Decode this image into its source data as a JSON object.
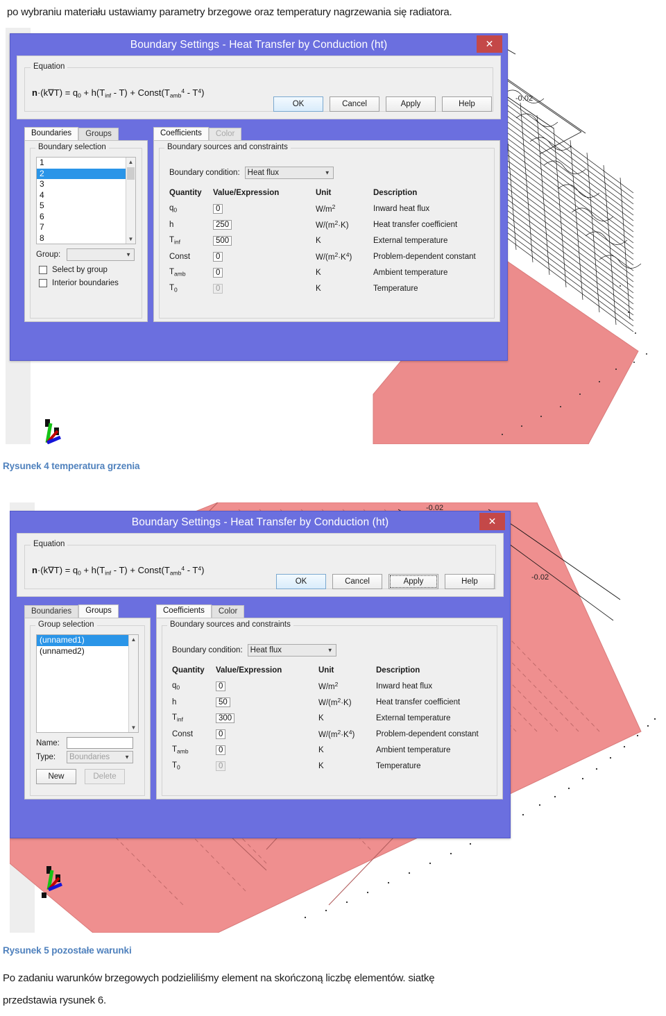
{
  "document": {
    "intro_paragraph": "po wybraniu materiału ustawiamy parametry brzegowe  oraz temperatury nagrzewania się radiatora.",
    "caption_fig4": "Rysunek 4 temperatura grzenia",
    "caption_fig5": "Rysunek 5 pozostałe warunki",
    "outro_line1": "Po zadaniu warunków brzegowych podzieliliśmy element  na skończoną liczbę elementów. siatkę",
    "outro_line2": "przedstawia rysunek 6.",
    "caption_color": "#4f81bd"
  },
  "figure1": {
    "axis_label": "-0.02",
    "geometry_color": "#ec8c8c",
    "triad_name": "axis-triad-icon"
  },
  "figure2": {
    "axis_label_top": "-0.02",
    "axis_label_right": "-0.02",
    "geometry_color": "#ec8c8c",
    "triad_name": "axis-triad-icon"
  },
  "dialog1": {
    "title": "Boundary Settings - Heat Transfer by Conduction (ht)",
    "close_label": "✕",
    "titlebar_color": "#6b6fdf",
    "close_color": "#c44848",
    "equation": {
      "legend": "Equation",
      "lhs_bold": "n",
      "text": "·(k∇T) = q0 + h(Tinf - T) + Const(Tamb4 - T4)"
    },
    "left_tabs": [
      {
        "label": "Boundaries",
        "active": true,
        "disabled": false
      },
      {
        "label": "Groups",
        "active": false,
        "disabled": false
      }
    ],
    "selection": {
      "legend": "Boundary selection",
      "items": [
        "1",
        "2",
        "3",
        "4",
        "5",
        "6",
        "7",
        "8"
      ],
      "selected_index": 1,
      "group_label": "Group:",
      "group_value": "",
      "checkboxes": [
        {
          "label": "Select by group",
          "checked": false
        },
        {
          "label": "Interior boundaries",
          "checked": false
        }
      ]
    },
    "right_tabs": [
      {
        "label": "Coefficients",
        "active": true,
        "disabled": false
      },
      {
        "label": "Color",
        "active": false,
        "disabled": true
      }
    ],
    "coefficients": {
      "legend": "Boundary sources and constraints",
      "bc_label": "Boundary condition:",
      "bc_value": "Heat flux",
      "headers": [
        "Quantity",
        "Value/Expression",
        "Unit",
        "Description"
      ],
      "rows": [
        {
          "qty": "q0",
          "value": "0",
          "unit": "W/m2",
          "desc": "Inward heat flux",
          "disabled": false,
          "caret": false
        },
        {
          "qty": "h",
          "value": "250",
          "unit": "W/(m2·K)",
          "desc": "Heat transfer coefficient",
          "disabled": false,
          "caret": false
        },
        {
          "qty": "Tinf",
          "value": "500",
          "unit": "K",
          "desc": "External temperature",
          "disabled": false,
          "caret": true
        },
        {
          "qty": "Const",
          "value": "0",
          "unit": "W/(m2·K4)",
          "desc": "Problem-dependent constant",
          "disabled": false,
          "caret": false
        },
        {
          "qty": "Tamb",
          "value": "0",
          "unit": "K",
          "desc": "Ambient temperature",
          "disabled": false,
          "caret": false
        },
        {
          "qty": "T0",
          "value": "0",
          "unit": "K",
          "desc": "Temperature",
          "disabled": true,
          "caret": false
        }
      ]
    },
    "buttons": [
      {
        "label": "OK",
        "style": "default"
      },
      {
        "label": "Cancel",
        "style": "normal"
      },
      {
        "label": "Apply",
        "style": "normal"
      },
      {
        "label": "Help",
        "style": "normal"
      }
    ]
  },
  "dialog2": {
    "title": "Boundary Settings - Heat Transfer by Conduction (ht)",
    "close_label": "✕",
    "titlebar_color": "#6b6fdf",
    "close_color": "#c44848",
    "equation": {
      "legend": "Equation",
      "lhs_bold": "n",
      "text": "·(k∇T) = q0 + h(Tinf - T) + Const(Tamb4 - T4)"
    },
    "left_tabs": [
      {
        "label": "Boundaries",
        "active": false,
        "disabled": false
      },
      {
        "label": "Groups",
        "active": true,
        "disabled": false
      }
    ],
    "selection": {
      "legend": "Group selection",
      "items": [
        "(unnamed1)",
        "(unnamed2)"
      ],
      "selected_index": 0,
      "name_label": "Name:",
      "name_value": "",
      "type_label": "Type:",
      "type_value": "Boundaries",
      "new_button": "New",
      "delete_button": "Delete"
    },
    "right_tabs": [
      {
        "label": "Coefficients",
        "active": true,
        "disabled": false
      },
      {
        "label": "Color",
        "active": false,
        "disabled": false
      }
    ],
    "coefficients": {
      "legend": "Boundary sources and constraints",
      "bc_label": "Boundary condition:",
      "bc_value": "Heat flux",
      "headers": [
        "Quantity",
        "Value/Expression",
        "Unit",
        "Description"
      ],
      "rows": [
        {
          "qty": "q0",
          "value": "0",
          "unit": "W/m2",
          "desc": "Inward heat flux",
          "disabled": false
        },
        {
          "qty": "h",
          "value": "50",
          "unit": "W/(m2·K)",
          "desc": "Heat transfer coefficient",
          "disabled": false
        },
        {
          "qty": "Tinf",
          "value": "300",
          "unit": "K",
          "desc": "External temperature",
          "disabled": false
        },
        {
          "qty": "Const",
          "value": "0",
          "unit": "W/(m2·K4)",
          "desc": "Problem-dependent constant",
          "disabled": false
        },
        {
          "qty": "Tamb",
          "value": "0",
          "unit": "K",
          "desc": "Ambient temperature",
          "disabled": false
        },
        {
          "qty": "T0",
          "value": "0",
          "unit": "K",
          "desc": "Temperature",
          "disabled": true
        }
      ]
    },
    "buttons": [
      {
        "label": "OK",
        "style": "default"
      },
      {
        "label": "Cancel",
        "style": "normal"
      },
      {
        "label": "Apply",
        "style": "focus"
      },
      {
        "label": "Help",
        "style": "normal"
      }
    ]
  }
}
